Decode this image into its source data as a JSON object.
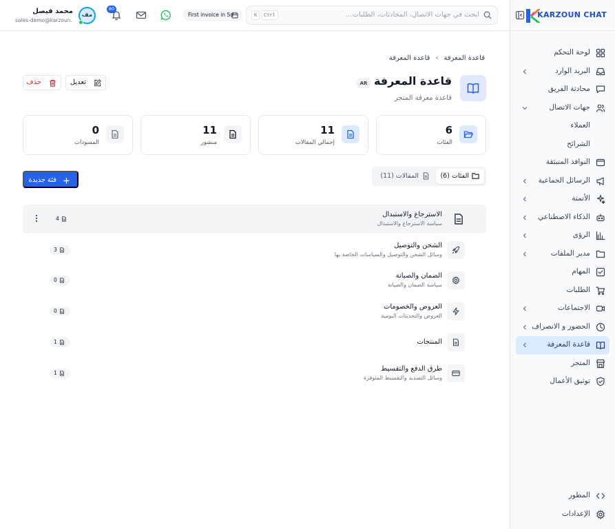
{
  "brand": {
    "name": "KARZOUN CHAT"
  },
  "header": {
    "search_placeholder": "ابحث في جهات الاتصال، المحادثات، الطلبات...",
    "kbd_ctrl": "Ctrl",
    "kbd_k": "K",
    "invoice_text": "First invoice in 5d",
    "notification_count": "80",
    "user_name": "محمد فيصل",
    "user_email": "sales-demo@karzoun...",
    "avatar_initials": "مف"
  },
  "sidebar": {
    "items": [
      {
        "label": "لوحة التحكم",
        "icon": "dashboard-icon",
        "chevron": false
      },
      {
        "label": "البريد الوارد",
        "icon": "inbox-icon",
        "chevron": true
      },
      {
        "label": "محادثة الفريق",
        "icon": "chat-icon",
        "chevron": false
      },
      {
        "label": "جهات الاتصال",
        "icon": "users-icon",
        "chevron": true,
        "expanded": true
      },
      {
        "label": "العملاء",
        "sub": true
      },
      {
        "label": "الشرائح",
        "sub": true
      },
      {
        "label": "النوافذ المنبثقة",
        "icon": "popup-icon",
        "chevron": false
      },
      {
        "label": "الرسائل الجماعية",
        "icon": "megaphone-icon",
        "chevron": true
      },
      {
        "label": "الأتمتة",
        "icon": "sparkles-icon",
        "chevron": true
      },
      {
        "label": "الذكاء الاصطناعي",
        "icon": "bot-icon",
        "chevron": true
      },
      {
        "label": "الرؤى",
        "icon": "chart-icon",
        "chevron": true
      },
      {
        "label": "مدير الملفات",
        "icon": "folder-icon",
        "chevron": true
      },
      {
        "label": "المهام",
        "icon": "checkbox-icon",
        "chevron": false
      },
      {
        "label": "الطلبات",
        "icon": "cart-icon",
        "chevron": false
      },
      {
        "label": "الاجتماعات",
        "icon": "video-icon",
        "chevron": true
      },
      {
        "label": "الحضور و الانصراف",
        "icon": "clock-icon",
        "chevron": true
      },
      {
        "label": "قاعدة المعرفة",
        "icon": "book-icon",
        "chevron": true,
        "active": true
      },
      {
        "label": "المتجر",
        "icon": "store-icon",
        "chevron": false
      },
      {
        "label": "توثيق الأعمال",
        "icon": "shield-check-icon",
        "chevron": false
      }
    ],
    "bottom": [
      {
        "label": "المطور",
        "icon": "code-icon"
      },
      {
        "label": "الإعدادات",
        "icon": "gear-icon"
      }
    ]
  },
  "page": {
    "breadcrumb": [
      "قاعدة المعرفة",
      "قاعدة المعرفة"
    ],
    "title": "قاعدة المعرفة",
    "lang": "AR",
    "subtitle": "قاعدة معرفة المتجر",
    "edit_label": "تعديل",
    "delete_label": "حذف"
  },
  "stats": [
    {
      "value": "6",
      "label": "الفئات",
      "icon": "folder-open-icon"
    },
    {
      "value": "11",
      "label": "إجمالي المقالات",
      "icon": "document-icon"
    },
    {
      "value": "11",
      "label": "منشور",
      "icon": "document-icon"
    },
    {
      "value": "0",
      "label": "المسودات",
      "icon": "document-icon"
    }
  ],
  "tabs": [
    {
      "label": "الفئات (6)",
      "icon": "folder-icon",
      "active": true
    },
    {
      "label": "المقالات (11)",
      "icon": "document-icon",
      "active": false
    }
  ],
  "new_category_label": "فئة جديدة",
  "categories": [
    {
      "name": "الاسترجاع والاستبدال",
      "desc": "سياسة الاسترجاع والاستبدال",
      "count": "4",
      "icon": "document-icon"
    },
    {
      "name": "الشحن والتوصيل",
      "desc": "وسائل الشحن والتوصيل والسياسات الخاصة بها",
      "count": "3",
      "icon": "rocket-icon"
    },
    {
      "name": "الضمان والصيانة",
      "desc": "سياسة الضمان والصيانة",
      "count": "0",
      "icon": "gear-icon"
    },
    {
      "name": "العروض والخصومات",
      "desc": "العروض والتحديثات اليومية",
      "count": "0",
      "icon": "lightning-icon"
    },
    {
      "name": "المنتجات",
      "desc": "",
      "count": "1",
      "icon": "document-icon"
    },
    {
      "name": "طرق الدفع والتقسيط",
      "desc": "وسائل التسديد والتقسيط المتوفرة",
      "count": "1",
      "icon": "credit-card-icon"
    }
  ],
  "colors": {
    "accent": "#2563eb",
    "danger": "#dc2626",
    "active_bg": "#dbeafe",
    "whatsapp": "#22c55e"
  }
}
